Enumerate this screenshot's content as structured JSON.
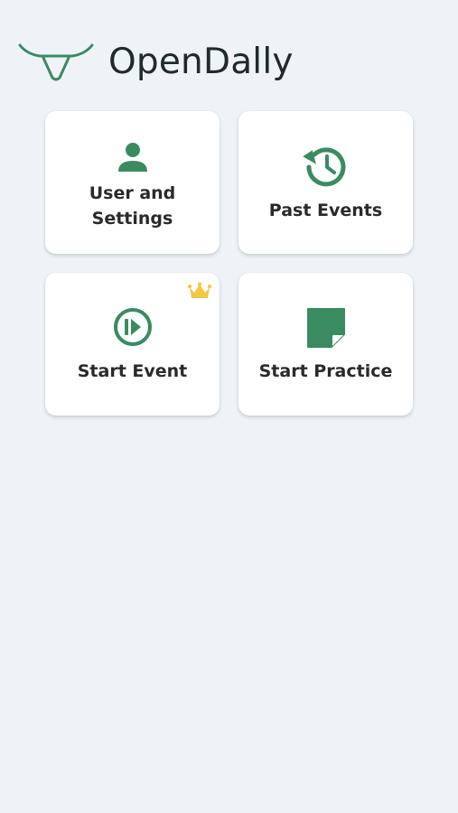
{
  "app": {
    "title": "OpenDally"
  },
  "colors": {
    "brand_green": "#3b8b61",
    "background": "#eff3f7",
    "tile_bg": "#ffffff",
    "crown": "#f4c542"
  },
  "tiles": [
    {
      "label": "User and Settings",
      "icon": "person-icon"
    },
    {
      "label": "Past Events",
      "icon": "history-icon"
    },
    {
      "label": "Start Event",
      "icon": "play-circle-icon",
      "badge": "crown-icon"
    },
    {
      "label": "Start Practice",
      "icon": "sticky-note-icon"
    }
  ]
}
